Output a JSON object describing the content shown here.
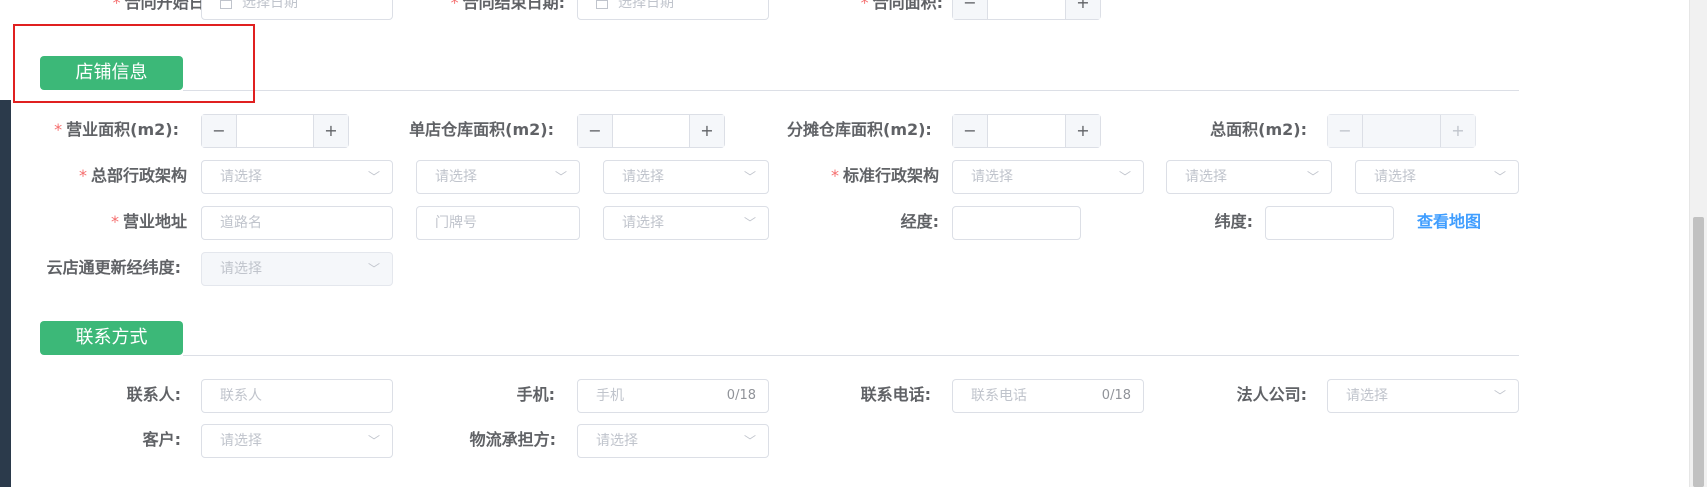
{
  "contract_row": {
    "start_date": {
      "label": "合同开始日期:",
      "placeholder": "选择日期"
    },
    "end_date": {
      "label": "合同结束日期:",
      "placeholder": "选择日期"
    },
    "area": {
      "label": "合同面积:",
      "minus": "−",
      "plus": "+"
    }
  },
  "store_section": {
    "title": "店铺信息",
    "business_area": {
      "label": "营业面积(m2):",
      "minus": "−",
      "plus": "+"
    },
    "single_store_warehouse_area": {
      "label": "单店仓库面积(m2):",
      "minus": "−",
      "plus": "+"
    },
    "shared_warehouse_area": {
      "label": "分摊仓库面积(m2):",
      "minus": "−",
      "plus": "+"
    },
    "total_area": {
      "label": "总面积(m2):",
      "minus": "−",
      "plus": "+"
    },
    "hq_org": {
      "label": "总部行政架构",
      "placeholders": [
        "请选择",
        "请选择",
        "请选择"
      ]
    },
    "std_org": {
      "label": "标准行政架构",
      "placeholders": [
        "请选择",
        "请选择",
        "请选择"
      ]
    },
    "business_address": {
      "label": "营业地址",
      "road_placeholder": "道路名",
      "number_placeholder": "门牌号",
      "select_placeholder": "请选择"
    },
    "longitude": {
      "label": "经度:"
    },
    "latitude": {
      "label": "纬度:"
    },
    "view_map": "查看地图",
    "cloud_update": {
      "label": "云店通更新经纬度:",
      "placeholder": "请选择"
    }
  },
  "contact_section": {
    "title": "联系方式",
    "contact_person": {
      "label": "联系人:",
      "placeholder": "联系人"
    },
    "mobile": {
      "label": "手机:",
      "placeholder": "手机",
      "count": "0/18"
    },
    "phone": {
      "label": "联系电话:",
      "placeholder": "联系电话",
      "count": "0/18"
    },
    "legal_company": {
      "label": "法人公司:",
      "placeholder": "请选择"
    },
    "customer": {
      "label": "客户:",
      "placeholder": "请选择"
    },
    "logistics": {
      "label": "物流承担方:",
      "placeholder": "请选择"
    }
  },
  "required_mark": "*",
  "icons": {
    "chevron": "chevron-down-icon",
    "calendar": "calendar-icon"
  },
  "colors": {
    "accent_green": "#3cb878",
    "link_blue": "#409eff",
    "required_red": "#f56c6c",
    "highlight_red": "#e02020"
  }
}
